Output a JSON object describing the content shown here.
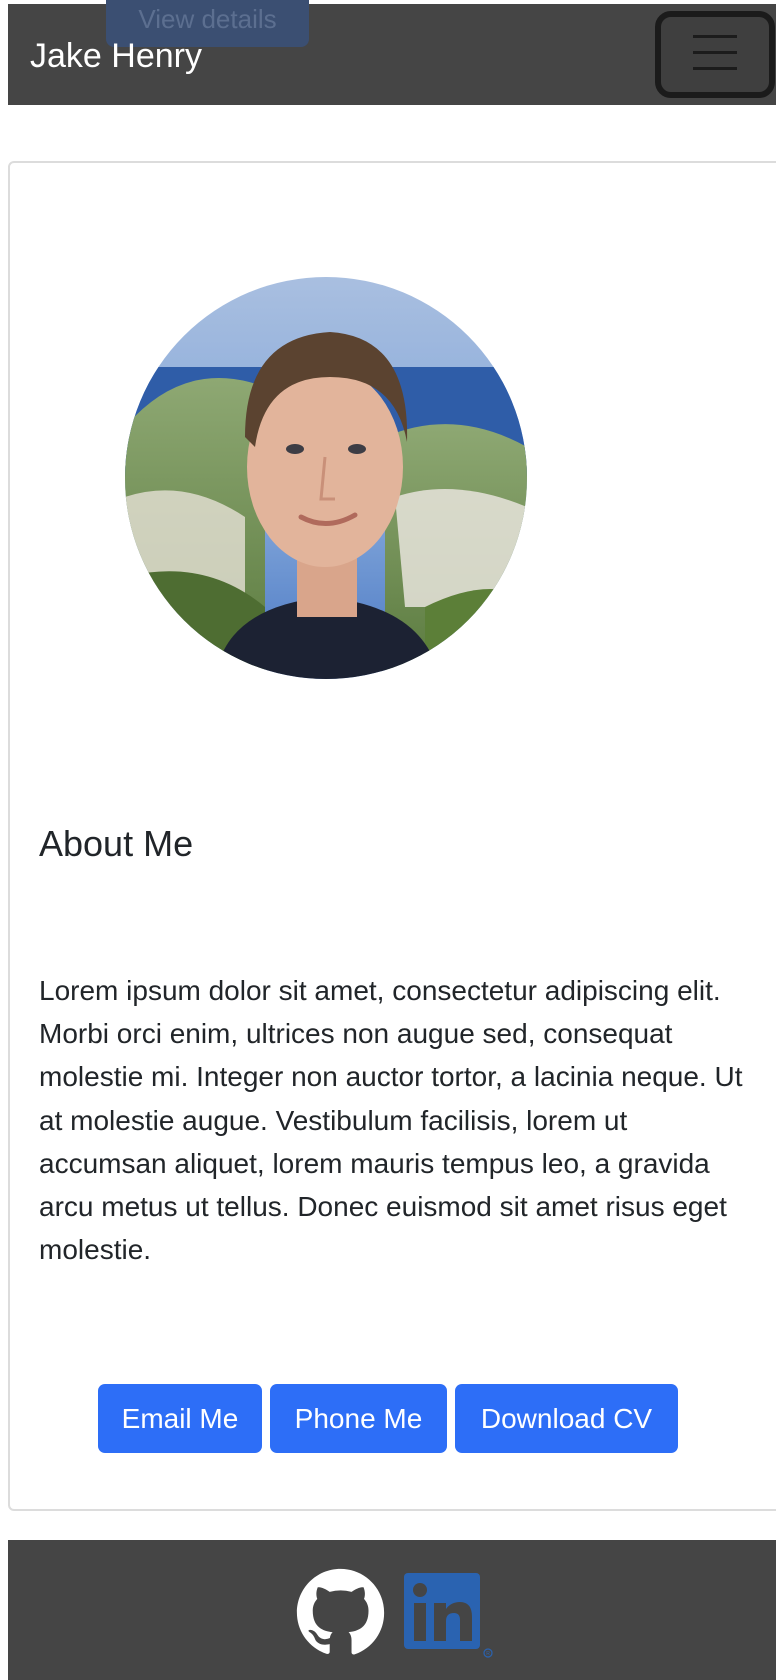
{
  "navbar": {
    "brand": "Jake Henry",
    "ghost_button_label": "View details",
    "toggler_label": "Toggle navigation"
  },
  "about": {
    "title": "About Me",
    "body": "Lorem ipsum dolor sit amet, consectetur adipiscing elit. Morbi orci enim, ultrices non augue sed, consequat molestie mi. Integer non auctor tortor, a lacinia neque. Ut at molestie augue. Vestibulum facilisis, lorem ut accumsan aliquet, lorem mauris tempus leo, a gravida arcu metus ut tellus. Donec euismod sit amet risus eget molestie."
  },
  "buttons": {
    "email": "Email Me",
    "phone": "Phone Me",
    "cv": "Download CV"
  },
  "footer": {
    "icons": [
      "github-icon",
      "linkedin-icon"
    ]
  },
  "colors": {
    "navbar_bg": "#454545",
    "button_bg": "#2d6ef7",
    "linkedin_blue": "#2a63b1"
  }
}
